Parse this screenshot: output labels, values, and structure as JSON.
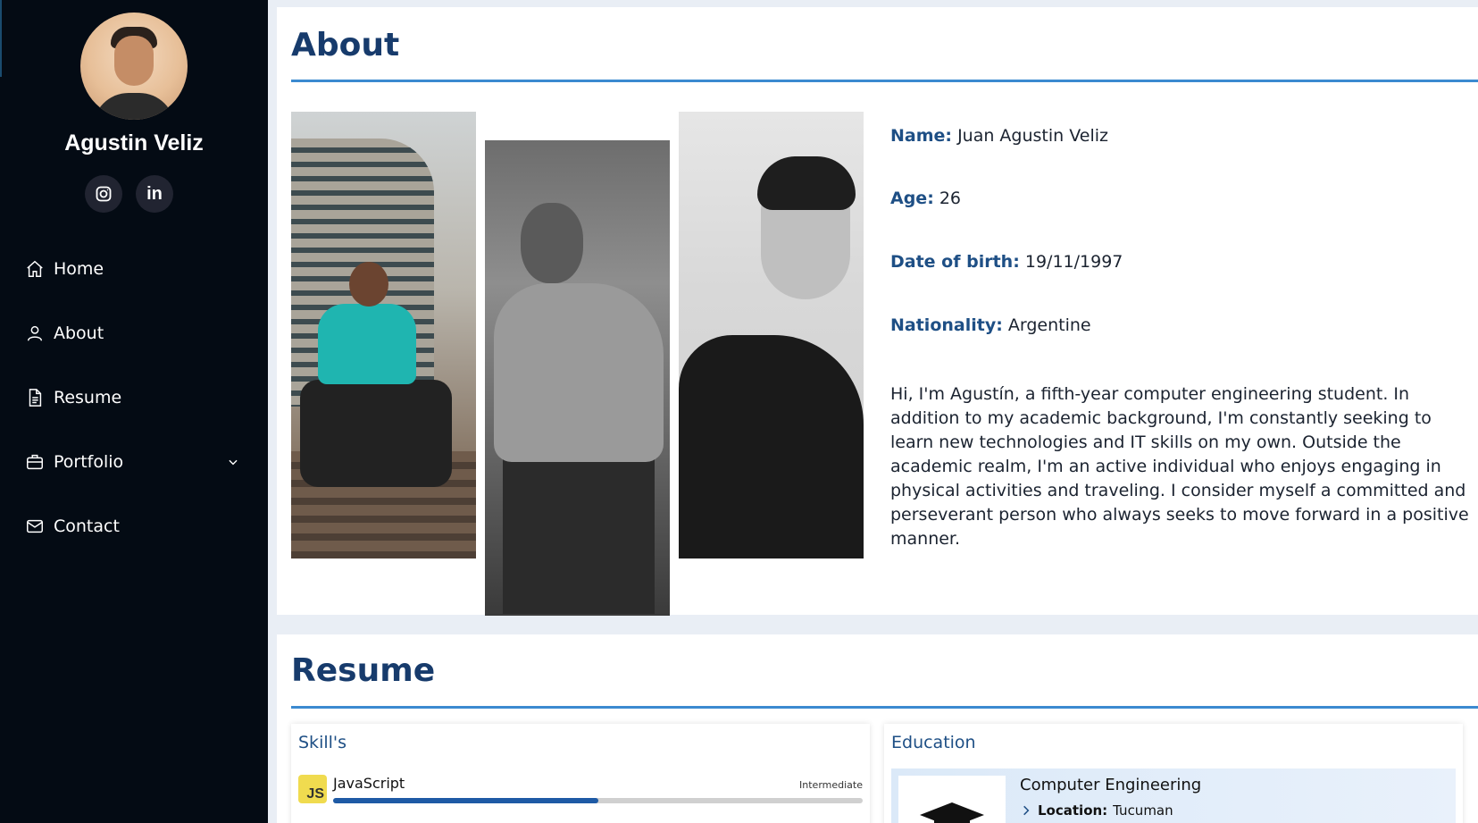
{
  "profile": {
    "name": "Agustin Veliz",
    "socials": [
      "instagram-icon",
      "linkedin-icon"
    ],
    "linkedin_label": "in"
  },
  "nav": {
    "items": [
      {
        "label": "Home",
        "icon": "home-icon"
      },
      {
        "label": "About",
        "icon": "user-icon"
      },
      {
        "label": "Resume",
        "icon": "document-icon"
      },
      {
        "label": "Portfolio",
        "icon": "briefcase-icon",
        "has_dropdown": true
      },
      {
        "label": "Contact",
        "icon": "envelope-icon"
      }
    ]
  },
  "about": {
    "title": "About",
    "fields": {
      "name_label": "Name:",
      "name_value": "Juan Agustin Veliz",
      "age_label": "Age:",
      "age_value": "26",
      "dob_label": "Date of birth:",
      "dob_value": "19/11/1997",
      "nationality_label": "Nationality:",
      "nationality_value": "Argentine"
    },
    "bio": "Hi, I'm Agustín, a fifth-year computer engineering student. In addition to my academic background, I'm constantly seeking to learn new technologies and IT skills on my own. Outside the academic realm, I'm an active individual who enjoys engaging in physical activities and traveling. I consider myself a committed and perseverant person who always seeks to move forward in a positive manner."
  },
  "resume": {
    "title": "Resume",
    "skills": {
      "title": "Skill's",
      "items": [
        {
          "badge": "JS",
          "name": "JavaScript",
          "level": "Intermediate",
          "progress": 0.5
        }
      ]
    },
    "education": {
      "title": "Education",
      "items": [
        {
          "degree": "Computer Engineering",
          "location_label": "Location:",
          "location": "Tucuman"
        }
      ]
    }
  },
  "colors": {
    "sidebar": "#040b14",
    "accent": "#3b8ad0",
    "title": "#173b6c",
    "label": "#1e4f85"
  }
}
